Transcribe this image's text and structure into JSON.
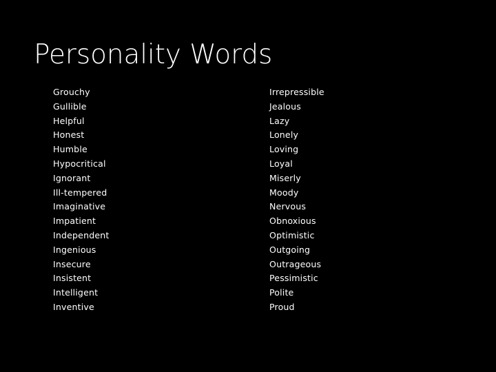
{
  "slide": {
    "title": "Personality Words",
    "background_color": "#000000",
    "text_color": "#ffffff"
  },
  "word_columns": {
    "left": [
      "Grouchy",
      "Gullible",
      "Helpful",
      "Honest",
      "Humble",
      "Hypocritical",
      "Ignorant",
      "Ill-tempered",
      "Imaginative",
      "Impatient",
      "Independent",
      "Ingenious",
      "Insecure",
      "Insistent",
      "Intelligent",
      "Inventive"
    ],
    "right": [
      "Irrepressible",
      "Jealous",
      "Lazy",
      "Lonely",
      "Loving",
      "Loyal",
      "Miserly",
      "Moody",
      "Nervous",
      "Obnoxious",
      "Optimistic",
      "Outgoing",
      "Outrageous",
      "Pessimistic",
      "Polite",
      "Proud"
    ]
  }
}
